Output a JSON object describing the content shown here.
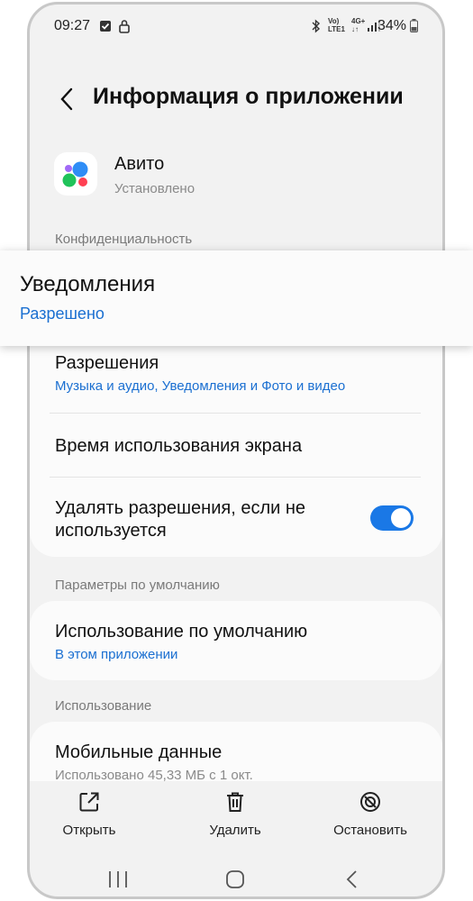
{
  "status_bar": {
    "time": "09:27",
    "battery": "34%",
    "network_icon": "volte-lte-icon",
    "data_icon": "4g-plus-icon"
  },
  "header": {
    "title": "Информация о приложении"
  },
  "app": {
    "name": "Авито",
    "state": "Установлено"
  },
  "sections": {
    "privacy": "Конфиденциальность",
    "defaults": "Параметры по умолчанию",
    "usage": "Использование"
  },
  "privacy_items": {
    "permissions_title": "Разрешения",
    "permissions_sub": "Музыка и аудио, Уведомления и Фото и видео",
    "screen_time_title": "Время использования экрана",
    "remove_permissions_line1": "Удалять разрешения, если не",
    "remove_permissions_line2": "используется",
    "remove_permissions_enabled": true
  },
  "defaults_item": {
    "title": "Использование по умолчанию",
    "sub": "В этом приложении"
  },
  "usage_item": {
    "title": "Мобильные данные",
    "sub": "Использовано 45,33 МБ с 1 окт."
  },
  "actions": {
    "open": "Открыть",
    "delete": "Удалить",
    "stop": "Остановить"
  },
  "popup": {
    "title": "Уведомления",
    "sub": "Разрешено"
  },
  "colors": {
    "accent": "#1a6fd1",
    "toggle": "#1a78e6"
  }
}
